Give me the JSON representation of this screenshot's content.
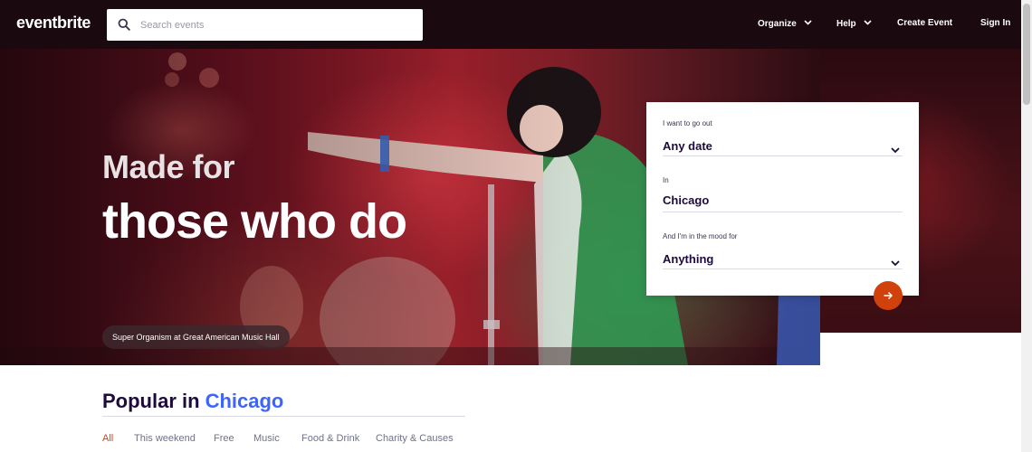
{
  "header": {
    "logo": "eventbrite",
    "search_placeholder": "Search events",
    "nav": {
      "organize": "Organize",
      "help": "Help",
      "create_event": "Create Event",
      "sign_in": "Sign In"
    }
  },
  "hero": {
    "title_line1": "Made for",
    "title_line2": "those who do",
    "caption": "Super Organism at Great American Music Hall"
  },
  "filter_card": {
    "date_label": "I want to go out",
    "date_value": "Any date",
    "location_label": "In",
    "location_value": "Chicago",
    "mood_label": "And I'm in the mood for",
    "mood_value": "Anything"
  },
  "popular": {
    "prefix": "Popular in",
    "city": "Chicago",
    "tabs": [
      "All",
      "This weekend",
      "Free",
      "Music",
      "Food & Drink",
      "Charity & Causes"
    ],
    "active_tab": "All"
  },
  "colors": {
    "brand_orange": "#d1410c",
    "city_blue": "#3d64ff",
    "navy_text": "#1e0a3c",
    "header_bg": "#1a0a10"
  }
}
